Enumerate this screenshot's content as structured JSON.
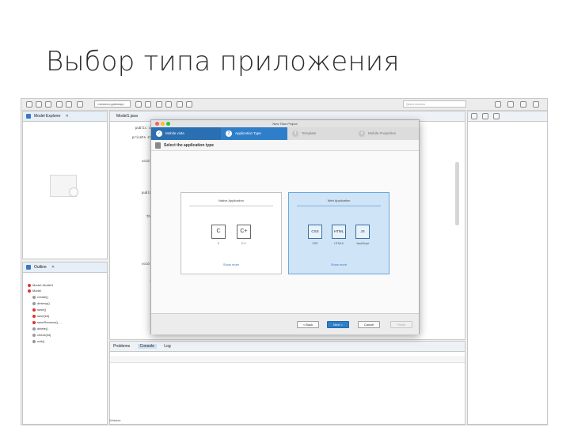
{
  "slide": {
    "title": "Выбор типа приложения"
  },
  "ide": {
    "toolbar": {
      "combo_value": "<session-gateway>",
      "search_placeholder": "Quick Access"
    },
    "explorer": {
      "tab_label": "Model Explorer"
    },
    "outline": {
      "tab_label": "Outline",
      "items": [
        "Model::Model1",
        "Model",
        "create()",
        "destroy()",
        "save()",
        "save(int)",
        "saveRemove(), ...",
        "delete()",
        "check(int)",
        "unit()"
      ]
    },
    "editor_tab": "Model1.java",
    "bottom_tabs": [
      "Problems",
      "Console",
      "Log"
    ],
    "status_text": "Writable"
  },
  "dialog": {
    "window_title": "New Titan Project",
    "steps": [
      {
        "num": "✓",
        "label": "Mobile vista"
      },
      {
        "num": "2",
        "label": "Application Type"
      },
      {
        "num": "3",
        "label": "Template"
      },
      {
        "num": "4",
        "label": "Mobile Properties"
      }
    ],
    "subtitle": "Select the application type",
    "cards": [
      {
        "title": "Native Application",
        "langs": [
          {
            "glyph": "C",
            "label": "C"
          },
          {
            "glyph": "C+",
            "label": "C++"
          }
        ],
        "link": "Show more"
      },
      {
        "title": "Web Application",
        "langs": [
          {
            "glyph": "CSS",
            "label": "CSS"
          },
          {
            "glyph": "HTML",
            "label": "HTML5"
          },
          {
            "glyph": "JS",
            "label": "JavaScript"
          }
        ],
        "link": "Show more"
      }
    ],
    "buttons": {
      "back": "< Back",
      "next": "Next >",
      "cancel": "Cancel",
      "finish": "Finish"
    }
  },
  "colors": {
    "accent": "#2f7ec9",
    "selected_card": "#cfe4f6"
  }
}
